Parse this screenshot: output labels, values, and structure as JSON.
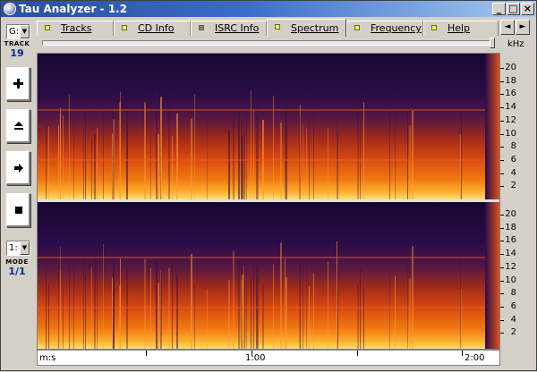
{
  "window": {
    "title": "Tau Analyzer - 1.2",
    "controls": [
      "_",
      "□",
      "×"
    ]
  },
  "tabs": [
    {
      "label": "Tracks",
      "led_color": "#f0f060",
      "active": false
    },
    {
      "label": "CD Info",
      "led_color": "#f0f060",
      "active": false
    },
    {
      "label": "ISRC Info",
      "led_color": "#808080",
      "active": false
    },
    {
      "label": "Spectrum",
      "led_color": "#f0f060",
      "active": true
    },
    {
      "label": "Frequency",
      "led_color": "#f0f060",
      "active": false
    },
    {
      "label": "Help",
      "led_color": "#f0f060",
      "active": false
    }
  ],
  "tab_scroll": {
    "left": "◄",
    "right": "►"
  },
  "toolbar": {
    "drive_value": "G:",
    "track_label": "TRACK",
    "track_number": "19",
    "buttons": [
      {
        "name": "zoom-in-button",
        "icon": "plus-icon"
      },
      {
        "name": "eject-button",
        "icon": "eject-icon"
      },
      {
        "name": "next-button",
        "icon": "arrow-right-icon"
      },
      {
        "name": "stop-button",
        "icon": "stop-icon"
      }
    ],
    "mode_value": "1:",
    "mode_label": "MODE",
    "mode_number": "1/1"
  },
  "spectrum": {
    "unit_label": "kHz",
    "top_ticks": [
      "20",
      "18",
      "16",
      "14",
      "12",
      "10",
      "8",
      "6",
      "4",
      "2"
    ],
    "bottom_ticks": [
      "20",
      "18",
      "16",
      "14",
      "12",
      "10",
      "8",
      "6",
      "4",
      "2"
    ],
    "channels": 2
  },
  "timeline": {
    "unit_label": "m:s",
    "labels": [
      "1:00",
      "2:00"
    ]
  },
  "colors": {
    "titlebar_start": "#2a4e9a",
    "titlebar_end": "#a6caf0",
    "spectrum_low": "#1c0c40",
    "spectrum_high": "#ffd040",
    "track_number": "#00308a"
  }
}
